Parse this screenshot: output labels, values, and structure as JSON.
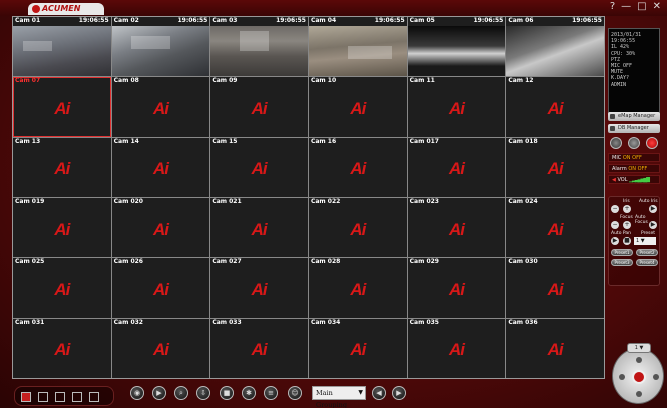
{
  "app": {
    "brand": "ACUMEN",
    "window_controls": [
      "?",
      "—",
      "□",
      "✕"
    ]
  },
  "feed_timestamp": "19:06:55",
  "live_cams": [
    {
      "label": "Cam 01",
      "time": "19:06:55"
    },
    {
      "label": "Cam 02",
      "time": "19:06:55"
    },
    {
      "label": "Cam 03",
      "time": "19:06:55"
    },
    {
      "label": "Cam 04",
      "time": "19:06:55"
    },
    {
      "label": "Cam 05",
      "time": "19:06:55"
    },
    {
      "label": "Cam 06",
      "time": "19:06:55"
    }
  ],
  "offline_cams": [
    "Cam 07",
    "Cam 08",
    "Cam 09",
    "Cam 10",
    "Cam 11",
    "Cam 12",
    "Cam 13",
    "Cam 14",
    "Cam 15",
    "Cam 16",
    "Cam 017",
    "Cam 018",
    "Cam 019",
    "Cam 020",
    "Cam 021",
    "Cam 022",
    "Cam 023",
    "Cam 024",
    "Cam 025",
    "Cam 026",
    "Cam 027",
    "Cam 028",
    "Cam 029",
    "Cam 030",
    "Cam 031",
    "Cam 032",
    "Cam 033",
    "Cam 034",
    "Cam 035",
    "Cam 036"
  ],
  "placeholder_logo": "Ai",
  "selected_cam": "Cam 07",
  "info_panel": {
    "date": "2013/01/31",
    "time": "19:06:55",
    "hdd": "IL 42%",
    "cpu": "CPU: 30%",
    "ptz": "PTZ",
    "mic": "MIC OFF",
    "mute": "MUTE",
    "kbd": "K.DAY?",
    "user": "ADMIN"
  },
  "side_buttons": {
    "emap": "eMap Manager",
    "db": "DB Manager"
  },
  "strips": {
    "mic": "MIC",
    "alarm": "Alarm",
    "vol": "VOL",
    "on": "ON",
    "off": "OFF"
  },
  "ptz": {
    "iris": "Iris",
    "auto_iris": "Auto Iris",
    "focus": "Focus",
    "auto_focus": "Auto Focus",
    "auto_pan": "Auto Pan",
    "preset": "Preset",
    "preset_value": "1",
    "presets": [
      "Preset1",
      "Preset2",
      "Preset3",
      "Preset4"
    ]
  },
  "toolbar": {
    "grouping": "Main Grouping"
  },
  "colors": {
    "accent": "#c01414",
    "brand_bg": "#5a0a0a"
  }
}
